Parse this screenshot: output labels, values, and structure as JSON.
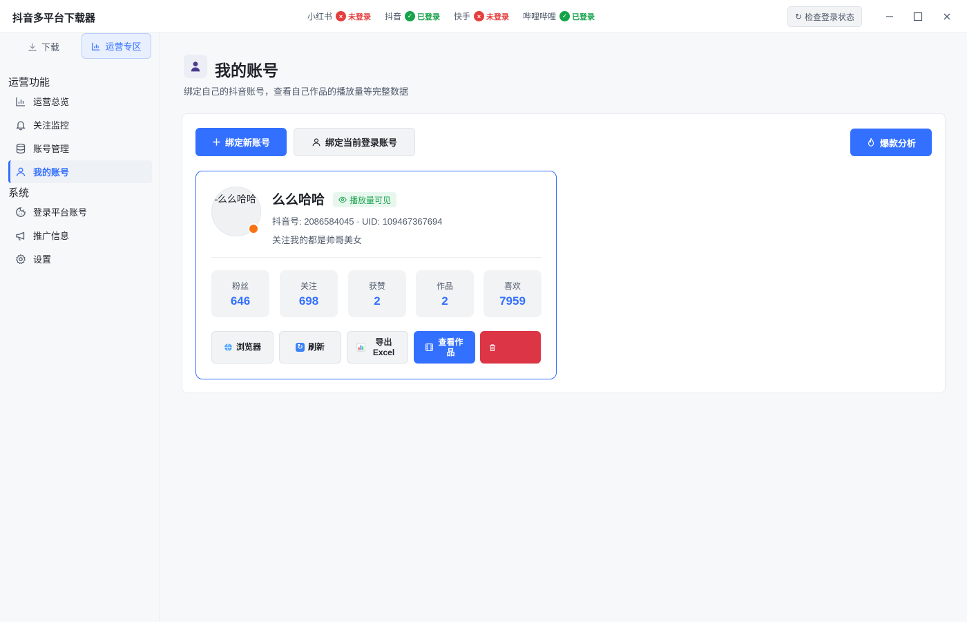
{
  "app": {
    "title": "抖音多平台下载器"
  },
  "platforms": [
    {
      "name": "小红书",
      "status": "未登录",
      "logged_in": false
    },
    {
      "name": "抖音",
      "status": "已登录",
      "logged_in": true
    },
    {
      "name": "快手",
      "status": "未登录",
      "logged_in": false
    },
    {
      "name": "哔哩哔哩",
      "status": "已登录",
      "logged_in": true
    }
  ],
  "titlebar": {
    "check_login_label": "检查登录状态"
  },
  "sidebar": {
    "mode_tabs": [
      {
        "label": "下载",
        "active": false
      },
      {
        "label": "运营专区",
        "active": true
      }
    ],
    "sections": [
      {
        "title": "运营功能",
        "items": [
          {
            "label": "运营总览",
            "icon": "bar-chart-icon",
            "active": false
          },
          {
            "label": "关注监控",
            "icon": "bell-icon",
            "active": false
          },
          {
            "label": "账号管理",
            "icon": "database-icon",
            "active": false
          },
          {
            "label": "我的账号",
            "icon": "user-icon",
            "active": true
          }
        ]
      },
      {
        "title": "系统",
        "items": [
          {
            "label": "登录平台账号",
            "icon": "cookie-icon",
            "active": false
          },
          {
            "label": "推广信息",
            "icon": "megaphone-icon",
            "active": false
          },
          {
            "label": "设置",
            "icon": "gear-icon",
            "active": false
          }
        ]
      }
    ]
  },
  "main": {
    "title": "我的账号",
    "description": "绑定自己的抖音账号，查看自己作品的播放量等完整数据",
    "toolbar": {
      "bind_new_label": "绑定新账号",
      "bind_current_label": "绑定当前登录账号",
      "hot_analysis_label": "爆款分析"
    },
    "account": {
      "avatar_alt": "么么哈哈",
      "name": "么么哈哈",
      "visibility_badge": "播放量可见",
      "ids": "抖音号: 2086584045 · UID: 109467367694",
      "bio": "关注我的都是帅哥美女",
      "stats": [
        {
          "label": "粉丝",
          "value": "646"
        },
        {
          "label": "关注",
          "value": "698"
        },
        {
          "label": "获赞",
          "value": "2"
        },
        {
          "label": "作品",
          "value": "2"
        },
        {
          "label": "喜欢",
          "value": "7959"
        }
      ],
      "actions": {
        "browser_label": "浏览器",
        "refresh_label": "刷新",
        "export_label": "导出Excel",
        "view_works_label": "查看作品"
      }
    }
  },
  "colors": {
    "accent": "#3370ff",
    "danger": "#dc3545",
    "success": "#16a34a",
    "error": "#e53e3e"
  }
}
